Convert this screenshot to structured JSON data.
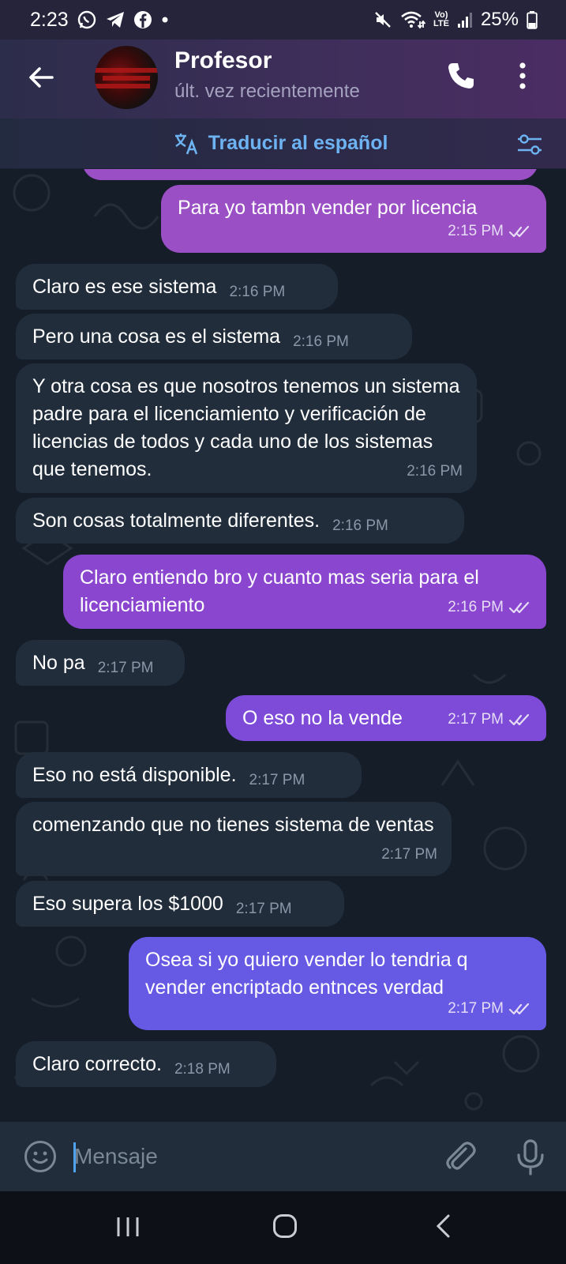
{
  "status_bar": {
    "time": "2:23",
    "battery": "25%",
    "network_label": "VoLTE"
  },
  "header": {
    "title": "Profesor",
    "status": "últ. vez recientemente"
  },
  "translate_bar": {
    "label": "Traducir al español"
  },
  "messages": [
    {
      "dir": "out",
      "text": "Para yo tambn vender por licencia",
      "time": "2:15 PM",
      "color": "#9a4fc4"
    },
    {
      "dir": "in",
      "text": "Claro es ese sistema",
      "time": "2:16 PM"
    },
    {
      "dir": "in",
      "text": "Pero una cosa es el sistema",
      "time": "2:16 PM"
    },
    {
      "dir": "in",
      "text": "Y otra cosa es que nosotros tenemos un sistema padre para el licenciamiento y verificación de licencias de todos y cada uno de los sistemas que tenemos.",
      "time": "2:16 PM"
    },
    {
      "dir": "in",
      "text": "Son cosas totalmente diferentes.",
      "time": "2:16 PM"
    },
    {
      "dir": "out",
      "text": "Claro entiendo bro y cuanto mas seria para el licenciamiento",
      "time": "2:16 PM",
      "color": "#8a46cf"
    },
    {
      "dir": "in",
      "text": "No pa",
      "time": "2:17 PM"
    },
    {
      "dir": "out",
      "text": "O eso no la vende",
      "time": "2:17 PM",
      "color": "#7d4bd8"
    },
    {
      "dir": "in",
      "text": "Eso no está disponible.",
      "time": "2:17 PM"
    },
    {
      "dir": "in",
      "text": "comenzando que no tienes sistema de ventas",
      "time": "2:17 PM"
    },
    {
      "dir": "in",
      "text": "Eso supera los $1000",
      "time": "2:17 PM"
    },
    {
      "dir": "out",
      "text": "Osea si yo quiero vender lo tendria q vender encriptado entnces verdad",
      "time": "2:17 PM",
      "color": "#6659e4"
    },
    {
      "dir": "in",
      "text": "Claro correcto.",
      "time": "2:18 PM"
    }
  ],
  "input": {
    "placeholder": "Mensaje"
  },
  "colors": {
    "accent": "#6db3f2",
    "incoming_bubble": "#212d3b",
    "chat_background": "#141d28"
  }
}
